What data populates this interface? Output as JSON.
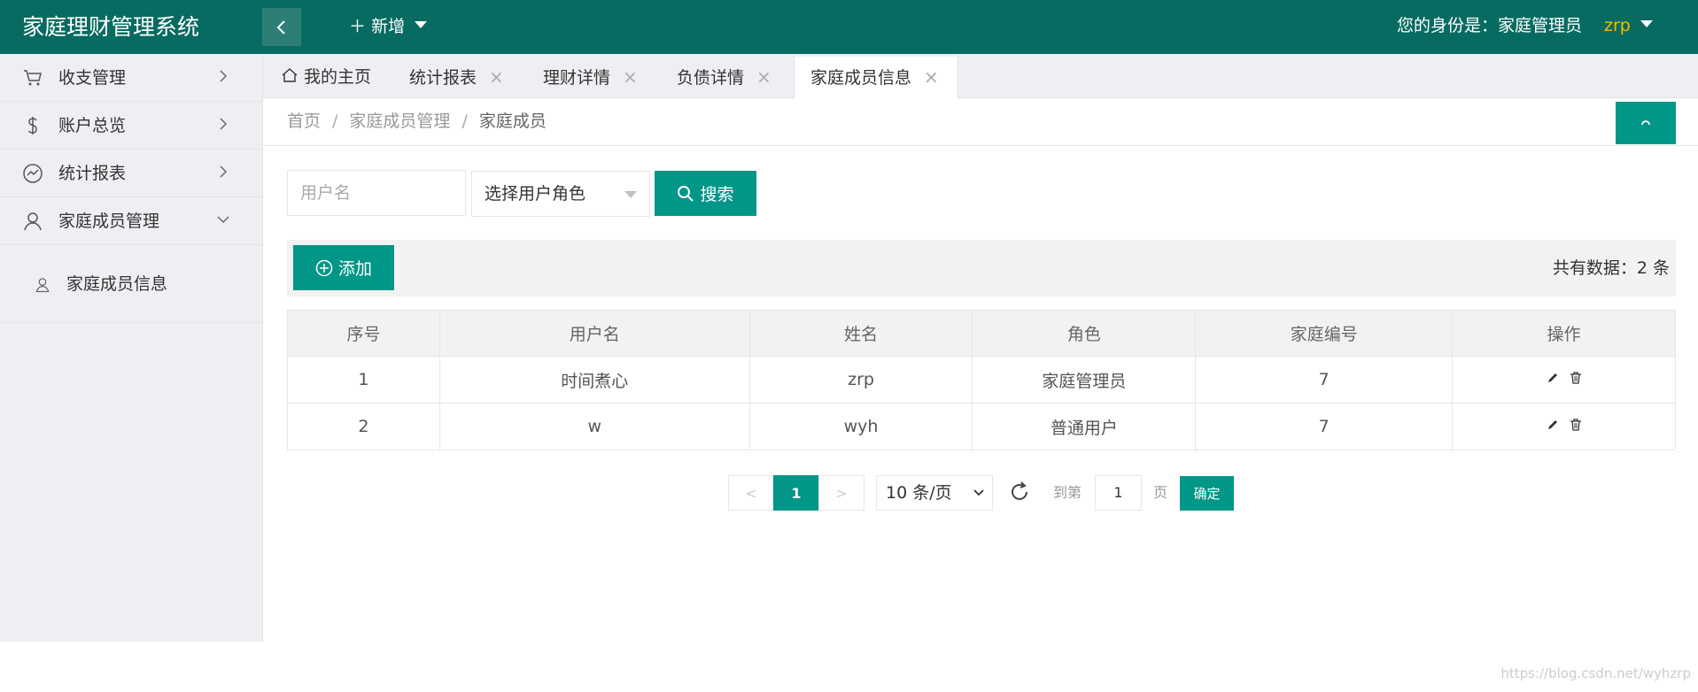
{
  "header": {
    "app_title": "家庭理财管理系统",
    "add_new_label": "新增",
    "role_text": "您的身份是：家庭管理员",
    "user_name": "zrp",
    "accent_color": "#076b61"
  },
  "sidebar": {
    "items": [
      {
        "label": "收支管理",
        "icon": "cart-icon"
      },
      {
        "label": "账户总览",
        "icon": "dollar-icon"
      },
      {
        "label": "统计报表",
        "icon": "chart-icon"
      },
      {
        "label": "家庭成员管理",
        "icon": "user-icon",
        "expanded": true
      }
    ],
    "sub_items": [
      {
        "label": "家庭成员信息",
        "icon": "user-icon"
      }
    ]
  },
  "tabs": [
    {
      "label": "我的主页",
      "closable": false
    },
    {
      "label": "统计报表",
      "closable": true
    },
    {
      "label": "理财详情",
      "closable": true
    },
    {
      "label": "负债详情",
      "closable": true
    },
    {
      "label": "家庭成员信息",
      "closable": true,
      "active": true
    }
  ],
  "breadcrumb": {
    "home": "首页",
    "level2": "家庭成员管理",
    "current": "家庭成员"
  },
  "search": {
    "username_placeholder": "用户名",
    "role_select_value": "选择用户角色",
    "search_button": "搜索"
  },
  "toolbar": {
    "add_button": "添加",
    "total_text": "共有数据：2 条"
  },
  "table": {
    "columns": [
      "序号",
      "用户名",
      "姓名",
      "角色",
      "家庭编号",
      "操作"
    ],
    "rows": [
      [
        "1",
        "时间煮心",
        "zrp",
        "家庭管理员",
        "7"
      ],
      [
        "2",
        "w",
        "wyh",
        "普通用户",
        "7"
      ]
    ]
  },
  "pagination": {
    "prev": "<",
    "current_page": "1",
    "next": ">",
    "page_size": "10 条/页",
    "goto_label": "到第",
    "goto_value": "1",
    "page_unit": "页",
    "confirm": "确定"
  },
  "watermark": "https://blog.csdn.net/wyhzrp"
}
